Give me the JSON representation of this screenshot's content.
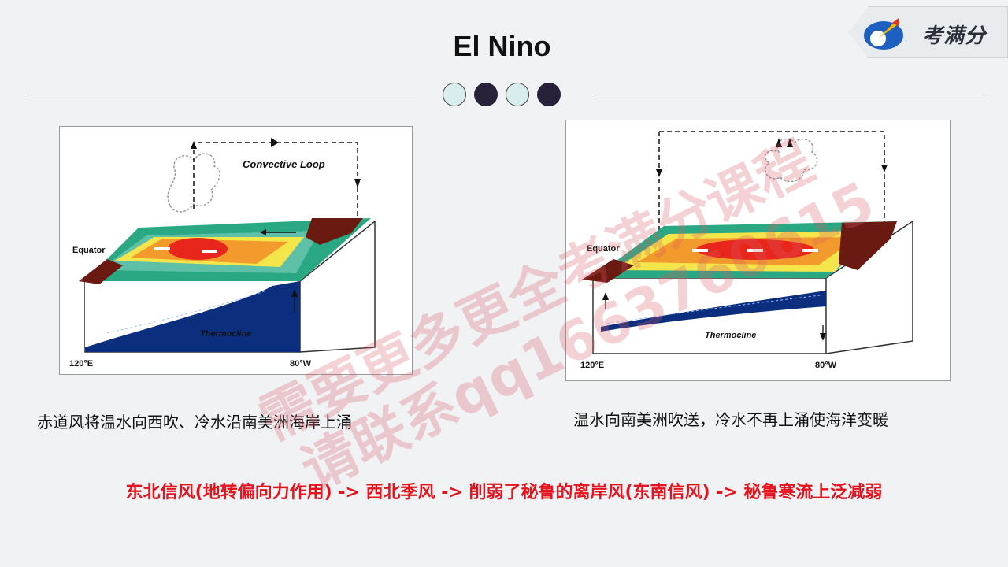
{
  "title": "El Nino",
  "logo": {
    "text": "考满分"
  },
  "diagrams": {
    "left": {
      "convective_label": "Convective Loop",
      "equator_label": "Equator",
      "thermocline_label": "Thermocline",
      "lon_west": "120°E",
      "lon_east": "80°W"
    },
    "right": {
      "equator_label": "Equator",
      "thermocline_label": "Thermocline",
      "lon_west": "120°E",
      "lon_east": "80°W"
    }
  },
  "captions": {
    "left": "赤道风将温水向西吹、冷水沿南美洲海岸上涌",
    "right": "温水向南美洲吹送，冷水不再上涌使海洋变暖"
  },
  "summary": "东北信风(地转偏向力作用) -> 西北季风 -> 削弱了秘鲁的离岸风(东南信风) -> 秘鲁寒流上泛减弱",
  "watermark": {
    "line1": "需要更多更全考满分课程",
    "line2": "请联系qq1663760615"
  },
  "colors": {
    "title": "#111111",
    "summary": "#e4131d",
    "ocean_deep": "#0b2f7e",
    "warm_core": "#e8261c"
  }
}
